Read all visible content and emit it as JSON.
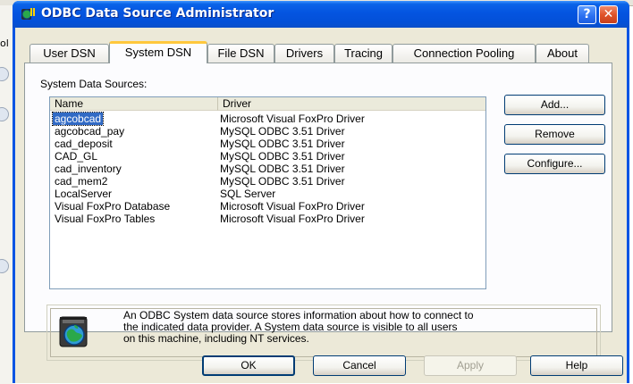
{
  "window": {
    "title": "ODBC Data Source Administrator",
    "help_glyph": "?",
    "close_glyph": "✕"
  },
  "background": {
    "fragment_text": "ol"
  },
  "tabs": [
    {
      "label": "User DSN"
    },
    {
      "label": "System DSN"
    },
    {
      "label": "File DSN"
    },
    {
      "label": "Drivers"
    },
    {
      "label": "Tracing"
    },
    {
      "label": "Connection Pooling"
    },
    {
      "label": "About"
    }
  ],
  "active_tab": "System DSN",
  "panel": {
    "list_label": "System Data Sources:",
    "columns": {
      "name": "Name",
      "driver": "Driver"
    },
    "rows": [
      {
        "name": "agcobcad",
        "driver": "Microsoft Visual FoxPro Driver"
      },
      {
        "name": "agcobcad_pay",
        "driver": "MySQL ODBC 3.51 Driver"
      },
      {
        "name": "cad_deposit",
        "driver": "MySQL ODBC 3.51 Driver"
      },
      {
        "name": "CAD_GL",
        "driver": "MySQL ODBC 3.51 Driver"
      },
      {
        "name": "cad_inventory",
        "driver": "MySQL ODBC 3.51 Driver"
      },
      {
        "name": "cad_mem2",
        "driver": "MySQL ODBC 3.51 Driver"
      },
      {
        "name": "LocalServer",
        "driver": "SQL Server"
      },
      {
        "name": "Visual FoxPro Database",
        "driver": "Microsoft Visual FoxPro Driver"
      },
      {
        "name": "Visual FoxPro Tables",
        "driver": "Microsoft Visual FoxPro Driver"
      }
    ],
    "selected_row": "agcobcad",
    "buttons": {
      "add": "Add...",
      "remove": "Remove",
      "configure": "Configure..."
    },
    "info": {
      "line1": "An ODBC System data source stores information about how to connect to",
      "line2": "the indicated data provider.  A System data source is visible to all users",
      "line3": "on this machine, including NT services."
    }
  },
  "dialog_buttons": {
    "ok": "OK",
    "cancel": "Cancel",
    "apply": "Apply",
    "help": "Help"
  },
  "colors": {
    "titlebar": "#0454e0",
    "dialog_face": "#ece9d8",
    "selection": "#316ac5",
    "active_tab_accent": "#ffc83c"
  },
  "icons": {
    "app": "odbc-globe-icon",
    "info": "database-globe-icon"
  }
}
